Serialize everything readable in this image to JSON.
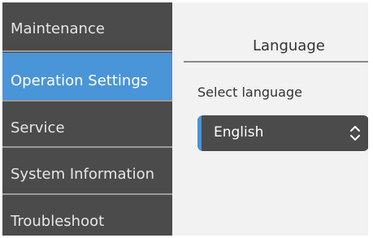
{
  "sidebar": {
    "items": [
      {
        "label": "Maintenance"
      },
      {
        "label": "Operation Settings"
      },
      {
        "label": "Service"
      },
      {
        "label": "System Information"
      },
      {
        "label": "Troubleshoot"
      }
    ],
    "active_index": 1
  },
  "main": {
    "title": "Language",
    "field_label": "Select language",
    "select": {
      "selected": "English",
      "icon": "up-down-chevron-icon"
    }
  },
  "colors": {
    "sidebar_bg": "#4b4b4b",
    "active_bg": "#4a94d8",
    "panel_bg": "#f2f2f2",
    "select_bg": "#4b4b4b"
  }
}
